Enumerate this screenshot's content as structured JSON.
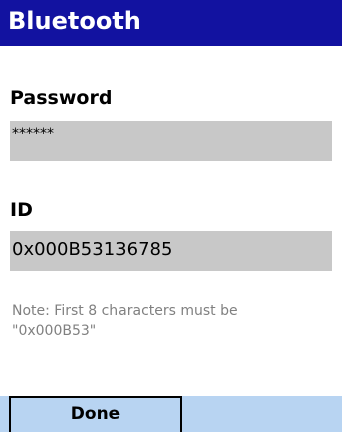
{
  "header": {
    "title": "Bluetooth"
  },
  "password": {
    "label": "Password",
    "value": "******"
  },
  "id": {
    "label": "ID",
    "value": "0x000B53136785"
  },
  "note": "Note: First 8 characters must be\n\"0x000B53\"",
  "menu": {
    "done_label": "Done"
  },
  "colors": {
    "title_bar": "#1212a0",
    "field_background": "#c8c8c8",
    "menu_bar": "#b8d4f2",
    "note_text": "#808080"
  }
}
